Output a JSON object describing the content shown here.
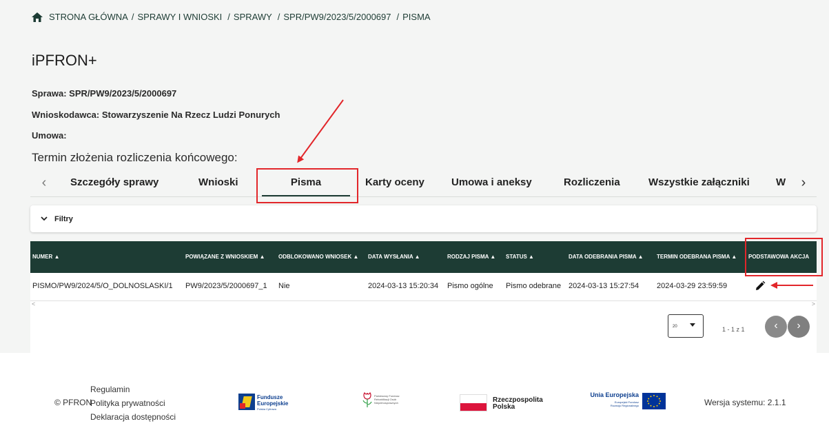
{
  "breadcrumb": {
    "home_icon": "home-icon",
    "items": [
      "STRONA GŁÓWNA",
      "SPRAWY I WNIOSKI",
      "SPRAWY",
      "SPR/PW9/2023/5/2000697",
      "PISMA"
    ],
    "separator": "/"
  },
  "app_title": "iPFRON+",
  "case": {
    "sprawa": "Sprawa: SPR/PW9/2023/5/2000697",
    "wnioskodawca": "Wnioskodawca: Stowarzyszenie Na Rzecz Ludzi Ponurych",
    "umowa": "Umowa:",
    "termin": "Termin złożenia rozliczenia końcowego:"
  },
  "tabs": {
    "prev_icon": "chevron-left-icon",
    "next_icon": "chevron-right-icon",
    "prev_glyph": "‹",
    "next_glyph": "›",
    "items": [
      "Szczegóły sprawy",
      "Wnioski",
      "Pisma",
      "Karty oceny",
      "Umowa i aneksy",
      "Rozliczenia",
      "Wszystkie załączniki",
      "W"
    ],
    "active": "Pisma"
  },
  "filters": {
    "label": "Filtry",
    "chevron": "⌄"
  },
  "table": {
    "sort_glyph": "▲",
    "headers": [
      "NUMER",
      "POWIĄZANE Z WNIOSKIEM",
      "ODBLOKOWANO WNIOSEK",
      "DATA WYSŁANIA",
      "RODZAJ PISMA",
      "STATUS",
      "DATA ODEBRANIA PISMA",
      "TERMIN ODEBRANA PISMA",
      "PODSTAWOWA AKCJA"
    ],
    "rows": [
      {
        "numer": "PISMO/PW9/2024/5/O_DOLNOSLASKI/1",
        "powiazane": "PW9/2023/5/2000697_1",
        "odblokowano": "Nie",
        "data_wyslania": "2024-03-13 15:20:34",
        "rodzaj": "Pismo ogólne",
        "status": "Pismo odebrane",
        "data_odebrania": "2024-03-13 15:27:54",
        "termin": "2024-03-29 23:59:59",
        "action_icon": "edit-pencil-icon"
      }
    ]
  },
  "pagination": {
    "page_size": "20",
    "range": "1 - 1 z 1",
    "prev": "‹",
    "next": "›"
  },
  "footer": {
    "copyright": "© PFRON",
    "links": [
      "Regulamin",
      "Polityka prywatności",
      "Deklaracja dostępności"
    ],
    "logos": {
      "fe_title": "Fundusze\nEuropejskie",
      "fe_sub": "Polska Cyfrowa",
      "pfron_text": "Państwowy Fundusz\nRehabilitacji Osób\nNiepełnosprawnych",
      "rp_text": "Rzeczpospolita\nPolska",
      "ue_title": "Unia Europejska",
      "ue_sub": "Europejski Fundusz\nRozwoju Regionalnego"
    },
    "version": "Wersja systemu: 2.1.1"
  },
  "colors": {
    "primary": "#1d3c34",
    "annotation": "#e2262a",
    "background": "#f4f5f4"
  }
}
